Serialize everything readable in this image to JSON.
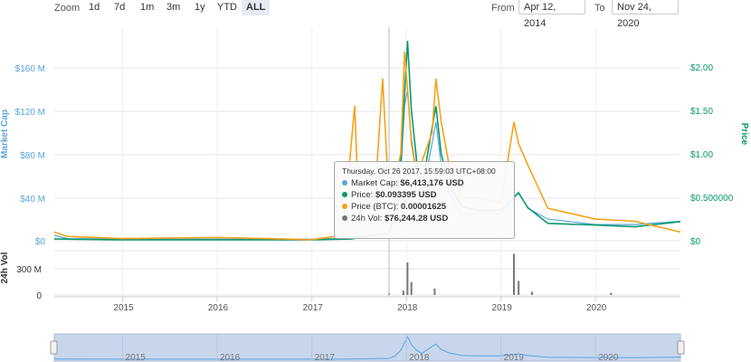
{
  "toolbar": {
    "zoom_label": "Zoom",
    "zoom_buttons": [
      "1d",
      "7d",
      "1m",
      "3m",
      "1y",
      "YTD",
      "ALL"
    ],
    "active": "ALL",
    "from_label": "From",
    "from_value": "Apr 12, 2014",
    "to_label": "To",
    "to_value": "Nov 24, 2020"
  },
  "colors": {
    "market_cap": "#5aa5dc",
    "price": "#0a9a6e",
    "price_btc": "#f4a21a",
    "volume": "#777777",
    "navigator_fill": "#c8d6ec"
  },
  "chart_data": {
    "type": "line",
    "x_range": [
      "2014-04-12",
      "2020-11-24"
    ],
    "x_ticks": [
      "2015",
      "2016",
      "2017",
      "2018",
      "2019",
      "2020"
    ],
    "left_axis": {
      "label": "Market Cap",
      "ticks": [
        "$0",
        "$40 M",
        "$80 M",
        "$120 M",
        "$160 M"
      ],
      "ylim": [
        0,
        160
      ]
    },
    "right_axis": {
      "label": "Price",
      "ticks": [
        "$0",
        "$0.500000",
        "$1.00",
        "$1.50",
        "$2.00"
      ],
      "ylim": [
        0,
        2.0
      ]
    },
    "volume_axis": {
      "label": "24h Vol",
      "ticks": [
        "0",
        "300 M"
      ]
    },
    "series": [
      {
        "name": "Market Cap",
        "axis": "left",
        "points": [
          [
            "2014-04-12",
            5
          ],
          [
            "2014-06-01",
            2
          ],
          [
            "2015-01-01",
            1.5
          ],
          [
            "2016-01-01",
            1.5
          ],
          [
            "2017-01-01",
            1.5
          ],
          [
            "2017-04-01",
            2
          ],
          [
            "2017-06-01",
            3
          ],
          [
            "2017-09-01",
            6
          ],
          [
            "2017-10-26",
            6.4
          ],
          [
            "2017-11-15",
            20
          ],
          [
            "2017-12-10",
            60
          ],
          [
            "2017-12-25",
            125
          ],
          [
            "2018-01-05",
            140
          ],
          [
            "2018-01-20",
            95
          ],
          [
            "2018-02-10",
            60
          ],
          [
            "2018-03-01",
            40
          ],
          [
            "2018-04-10",
            90
          ],
          [
            "2018-04-25",
            110
          ],
          [
            "2018-05-15",
            70
          ],
          [
            "2018-06-15",
            45
          ],
          [
            "2018-08-01",
            25
          ],
          [
            "2018-10-01",
            25
          ],
          [
            "2019-01-01",
            25
          ],
          [
            "2019-02-20",
            40
          ],
          [
            "2019-03-10",
            45
          ],
          [
            "2019-04-15",
            30
          ],
          [
            "2019-07-01",
            20
          ],
          [
            "2020-01-01",
            15
          ],
          [
            "2020-06-01",
            15
          ],
          [
            "2020-11-24",
            18
          ]
        ]
      },
      {
        "name": "Price",
        "axis": "right",
        "points": [
          [
            "2014-04-12",
            0.02
          ],
          [
            "2015-01-01",
            0.01
          ],
          [
            "2016-01-01",
            0.01
          ],
          [
            "2017-01-01",
            0.01
          ],
          [
            "2017-06-01",
            0.02
          ],
          [
            "2017-10-26",
            0.093395
          ],
          [
            "2017-11-15",
            0.3
          ],
          [
            "2017-12-10",
            0.9
          ],
          [
            "2017-12-25",
            1.7
          ],
          [
            "2018-01-05",
            2.3
          ],
          [
            "2018-01-20",
            1.5
          ],
          [
            "2018-02-10",
            0.9
          ],
          [
            "2018-03-01",
            0.6
          ],
          [
            "2018-04-10",
            1.3
          ],
          [
            "2018-04-25",
            1.55
          ],
          [
            "2018-05-15",
            1.0
          ],
          [
            "2018-06-15",
            0.65
          ],
          [
            "2018-08-01",
            0.4
          ],
          [
            "2018-10-01",
            0.35
          ],
          [
            "2019-01-01",
            0.35
          ],
          [
            "2019-02-20",
            0.5
          ],
          [
            "2019-03-10",
            0.55
          ],
          [
            "2019-04-15",
            0.38
          ],
          [
            "2019-07-01",
            0.2
          ],
          [
            "2020-01-01",
            0.18
          ],
          [
            "2020-06-01",
            0.16
          ],
          [
            "2020-11-24",
            0.22
          ]
        ]
      },
      {
        "name": "Price (BTC)",
        "axis": "left",
        "points": [
          [
            "2014-04-12",
            8
          ],
          [
            "2014-06-01",
            4
          ],
          [
            "2015-01-01",
            2
          ],
          [
            "2016-01-01",
            3
          ],
          [
            "2017-01-01",
            1
          ],
          [
            "2017-05-01",
            5
          ],
          [
            "2017-06-15",
            125
          ],
          [
            "2017-07-01",
            25
          ],
          [
            "2017-09-01",
            40
          ],
          [
            "2017-10-01",
            150
          ],
          [
            "2017-10-26",
            35
          ],
          [
            "2017-12-10",
            80
          ],
          [
            "2017-12-25",
            175
          ],
          [
            "2018-01-05",
            140
          ],
          [
            "2018-01-20",
            90
          ],
          [
            "2018-02-10",
            60
          ],
          [
            "2018-04-10",
            100
          ],
          [
            "2018-04-25",
            150
          ],
          [
            "2018-05-15",
            110
          ],
          [
            "2018-06-15",
            70
          ],
          [
            "2018-08-01",
            40
          ],
          [
            "2018-10-01",
            40
          ],
          [
            "2019-01-01",
            35
          ],
          [
            "2019-02-20",
            110
          ],
          [
            "2019-03-10",
            90
          ],
          [
            "2019-04-15",
            70
          ],
          [
            "2019-07-01",
            30
          ],
          [
            "2020-01-01",
            20
          ],
          [
            "2020-06-01",
            18
          ],
          [
            "2020-11-24",
            8
          ]
        ]
      }
    ],
    "volume": [
      [
        "2017-10-26",
        15
      ],
      [
        "2017-12-20",
        40
      ],
      [
        "2018-01-05",
        300
      ],
      [
        "2018-01-20",
        120
      ],
      [
        "2018-04-20",
        60
      ],
      [
        "2019-02-20",
        380
      ],
      [
        "2019-03-10",
        130
      ],
      [
        "2019-05-01",
        30
      ],
      [
        "2020-03-01",
        20
      ]
    ],
    "tooltip": {
      "timestamp": "Thursday, Oct 26 2017, 15:59:03 UTC+08:00",
      "rows": [
        {
          "label": "Market Cap:",
          "value": "$6,413,176 USD",
          "color": "#5aa5dc"
        },
        {
          "label": "Price:",
          "value": "$0.093395 USD",
          "color": "#0a9a6e"
        },
        {
          "label": "Price (BTC):",
          "value": "0.00001625",
          "color": "#f4a21a"
        },
        {
          "label": "24h Vol:",
          "value": "$76,244.28 USD",
          "color": "#777777"
        }
      ]
    },
    "navigator": {
      "ticks": [
        "2015",
        "2016",
        "2017",
        "2018",
        "2019",
        "2020"
      ]
    }
  }
}
